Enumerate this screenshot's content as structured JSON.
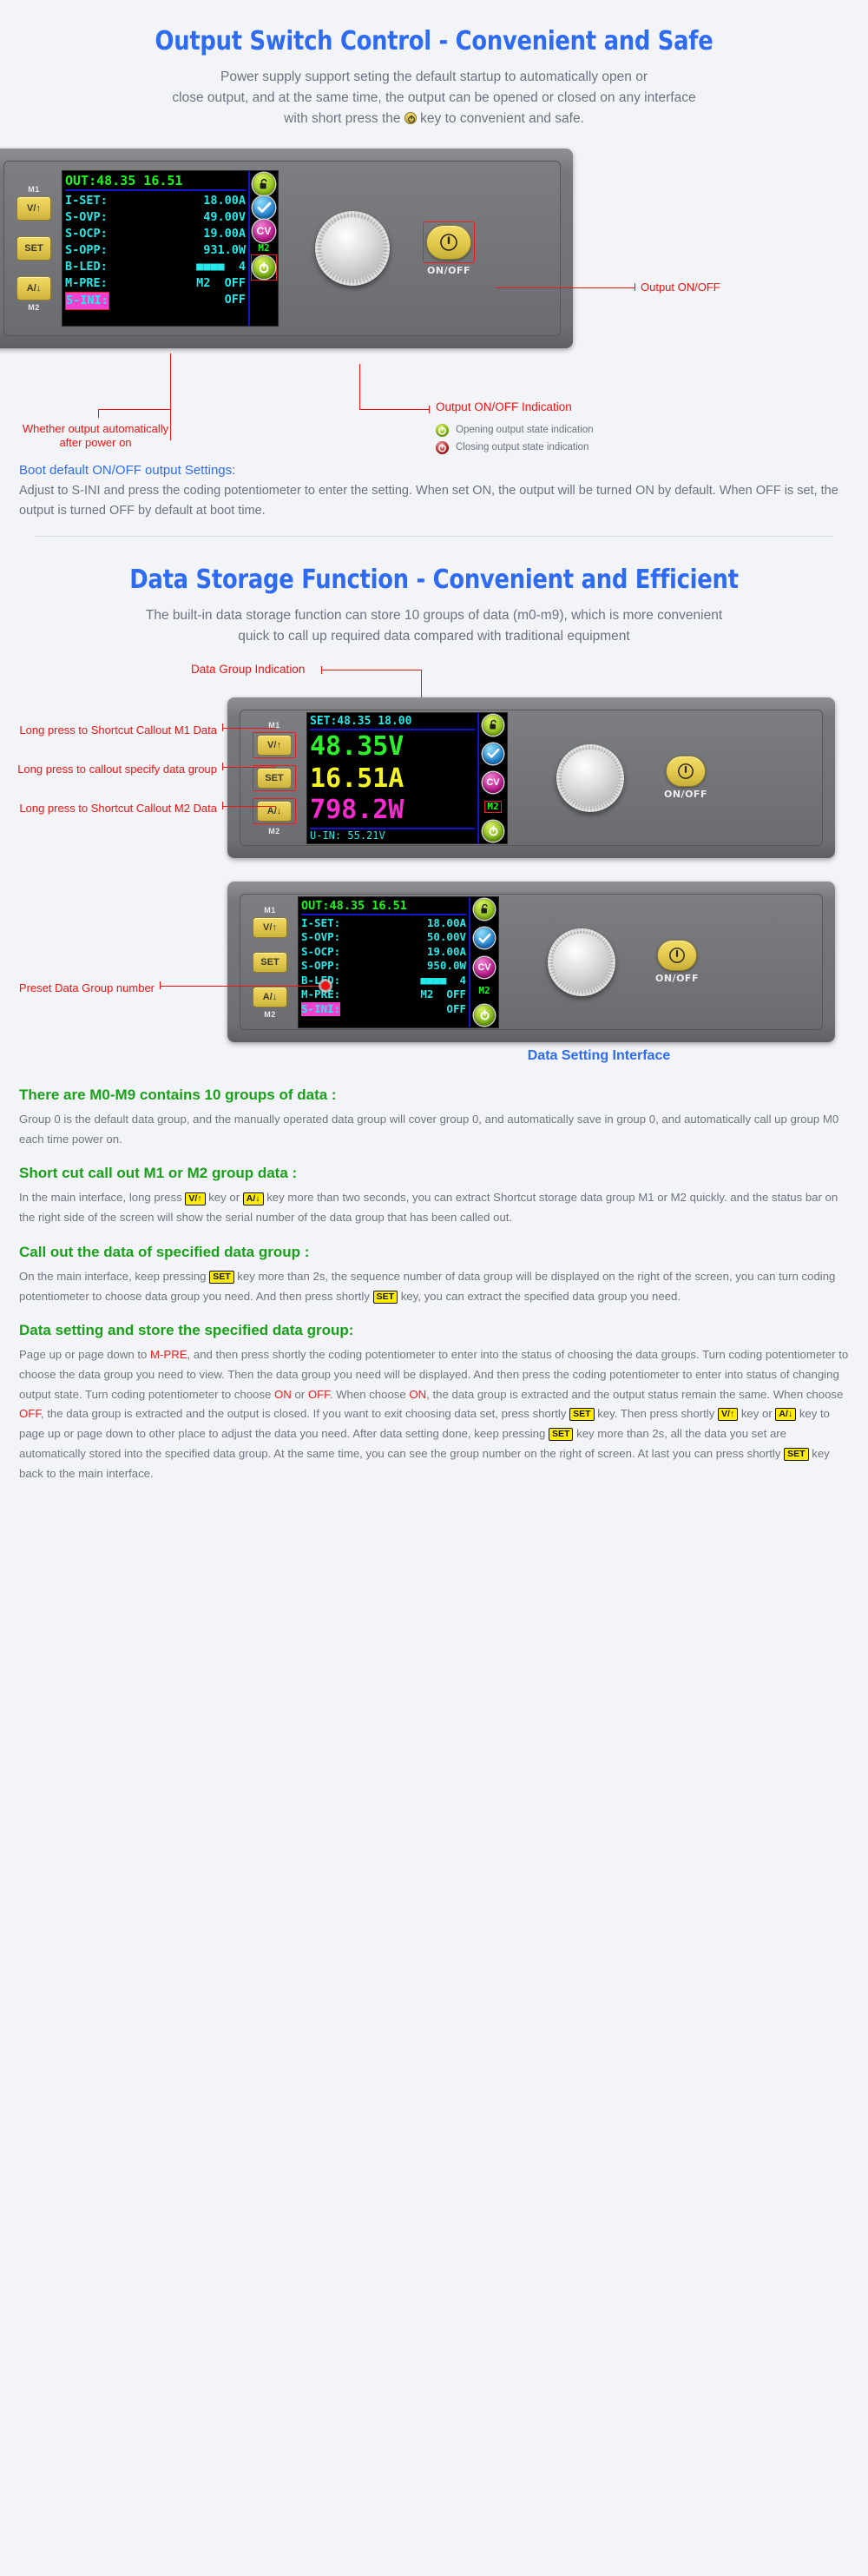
{
  "section1": {
    "title": "Output Switch Control - Convenient and Safe",
    "sub_line1": "Power supply support seting the default startup to automatically open or",
    "sub_line2": "close output, and at the same time, the output can be opened or closed on any interface",
    "sub_line3_a": "with short press the",
    "sub_line3_b": "key to convenient and safe.",
    "annotations": {
      "output_onoff": "Output ON/OFF",
      "auto_power_on_l1": "Whether output automatically",
      "auto_power_on_l2": "after power on",
      "indication_title": "Output ON/OFF Indication",
      "legend_on": "Opening output state indication",
      "legend_off": "Closing output state indication"
    },
    "note": {
      "title": "Boot default ON/OFF output Settings:",
      "body": "Adjust to S-INI and press the coding potentiometer to enter the setting. When set ON, the output will be turned ON by default. When OFF is set, the output is turned OFF by default at boot time."
    }
  },
  "device1": {
    "keys": {
      "m1": "M1",
      "v_up": "V/↑",
      "set": "SET",
      "a_down": "A/↓",
      "m2": "M2"
    },
    "lcd": {
      "top": "OUT:48.35 16.51",
      "rows": [
        {
          "label": "I-SET:",
          "value": "18.00A"
        },
        {
          "label": "S-OVP:",
          "value": "49.00V"
        },
        {
          "label": "S-OCP:",
          "value": "19.00A"
        },
        {
          "label": "S-OPP:",
          "value": "931.0W"
        },
        {
          "label": "B-LED:",
          "value": "■■■■  4"
        },
        {
          "label": "M-PRE:",
          "value": "M2  OFF"
        },
        {
          "label": "S-INI:",
          "value": "OFF",
          "highlight": true
        }
      ],
      "sidebar": {
        "cv": "CV",
        "mtag": "M2"
      }
    },
    "onoff_label": "ON/OFF"
  },
  "section2": {
    "title": "Data Storage Function - Convenient and Efficient",
    "sub_line1": "The built-in data storage function can store 10 groups of data (m0-m9), which is more convenient",
    "sub_line2": "quick to call up required data compared with traditional equipment",
    "annotations": {
      "data_group_indication": "Data Group Indication",
      "m1_callout": "Long press to Shortcut Callout M1 Data",
      "specify_callout": "Long press to callout specify data group",
      "m2_callout": "Long press to Shortcut Callout M2 Data",
      "preset_group": "Preset Data Group number",
      "data_setting_interface": "Data Setting Interface"
    }
  },
  "device2": {
    "keys": {
      "m1": "M1",
      "v_up": "V/↑",
      "set": "SET",
      "a_down": "A/↓",
      "m2": "M2"
    },
    "lcd": {
      "top": "SET:48.35 18.00",
      "voltage": "48.35V",
      "current": "16.51A",
      "power": "798.2W",
      "uin": "U-IN: 55.21V",
      "sidebar": {
        "cv": "CV",
        "mtag": "M2"
      }
    },
    "onoff_label": "ON/OFF"
  },
  "device3": {
    "keys": {
      "m1": "M1",
      "v_up": "V/↑",
      "set": "SET",
      "a_down": "A/↓",
      "m2": "M2"
    },
    "lcd": {
      "top": "OUT:48.35 16.51",
      "rows": [
        {
          "label": "I-SET:",
          "value": "18.00A"
        },
        {
          "label": "S-OVP:",
          "value": "50.00V"
        },
        {
          "label": "S-OCP:",
          "value": "19.00A"
        },
        {
          "label": "S-OPP:",
          "value": "950.0W"
        },
        {
          "label": "B-LED:",
          "value": "■■■■  4"
        },
        {
          "label": "M-PRE:",
          "value": "M2  OFF"
        },
        {
          "label": "S-INI:",
          "value": "OFF",
          "highlight": true
        }
      ],
      "sidebar": {
        "cv": "CV",
        "mtag": "M2"
      }
    },
    "onoff_label": "ON/OFF"
  },
  "doc": {
    "s1_title": "There are M0-M9 contains 10 groups of data :",
    "s1_body": "Group 0 is the default data group, and the manually operated data group will cover group 0, and automatically save in group 0, and automatically call up group M0 each time power on.",
    "s2_title": "Short cut call out M1 or M2 group data :",
    "s2_p1": "In the main interface, long press",
    "s2_k1": "V/↑",
    "s2_p2": "key or",
    "s2_k2": "A/↓",
    "s2_p3": "key more than two seconds, you can extract Shortcut storage data group M1 or M2 quickly. and the status bar on the right side of the screen will show the serial number of the data group that has been called out.",
    "s3_title": "Call out the data of specified data group :",
    "s3_p1": "On the main interface, keep pressing",
    "s3_k1": "SET",
    "s3_p2": "key more than 2s, the sequence number of data group will be displayed on the right of the screen, you can turn coding potentiometer to choose data group you need. And then press shortly",
    "s3_k2": "SET",
    "s3_p3": "key, you can extract the specified data group you need.",
    "s4_title": "Data setting and store the specified data group:",
    "s4_p1": "Page up or page down to",
    "s4_r1": "M-PRE",
    "s4_p2": ", and then press shortly the coding potentiometer to enter into the status of choosing the data groups. Turn coding potentiometer to choose the data group you need to view. Then the data group you need will be displayed. And then press the coding potentiometer to enter into status of changing output state. Turn coding potentiometer to choose",
    "s4_r2": "ON",
    "s4_p3": "or",
    "s4_r3": "OFF",
    "s4_p4": ". When choose",
    "s4_r4": "ON",
    "s4_p5": ", the data group is extracted and the output status remain the same. When choose",
    "s4_r5": "OFF",
    "s4_p6": ", the data group is extracted and the output is closed. If you want to exit choosing data set, press shortly",
    "s4_k1": "SET",
    "s4_p7": "key. Then press shortly",
    "s4_k2": "V/↑",
    "s4_p8": "key or",
    "s4_k3": "A/↓",
    "s4_p9": "key to page up or page down to other place to adjust the data you need. After data setting done, keep pressing",
    "s4_k4": "SET",
    "s4_p10": "key more than 2s, all the data you set are automatically stored into the specified data group. At the same time, you can see the group number on the right of screen. At last you can press shortly",
    "s4_k5": "SET",
    "s4_p11": "key back to the main interface."
  },
  "colors": {
    "brand_blue": "#2f6bf2",
    "annotation_red": "#f01313",
    "heading_green": "#1aa01a",
    "lcd_cyan": "#25e8e8",
    "lcd_green": "#1cf51c",
    "key_yellow": "#e0c64e"
  }
}
